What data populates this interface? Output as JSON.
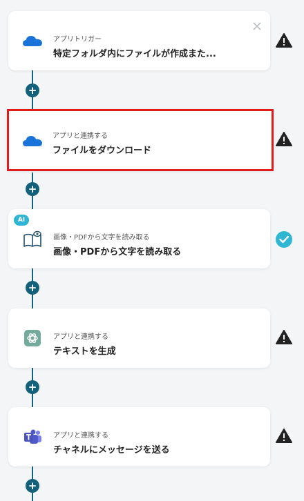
{
  "steps": [
    {
      "subtitle": "アプリトリガー",
      "title": "特定フォルダ内にファイルが作成また...",
      "icon": "onedrive-icon",
      "status": "warning"
    },
    {
      "subtitle": "アプリと連携する",
      "title": "ファイルをダウンロード",
      "icon": "onedrive-icon",
      "status": "warning"
    },
    {
      "subtitle": "画像・PDFから文字を読み取る",
      "title": "画像・PDFから文字を読み取る",
      "icon": "ocr-book-icon",
      "status": "done",
      "badge": "AI"
    },
    {
      "subtitle": "アプリと連携する",
      "title": "テキストを生成",
      "icon": "chatgpt-icon",
      "status": "warning"
    },
    {
      "subtitle": "アプリと連携する",
      "title": "チャネルにメッセージを送る",
      "icon": "teams-icon",
      "status": "warning"
    }
  ],
  "colors": {
    "connector": "#13607a",
    "selected_border": "#e01c1c",
    "done": "#2eb6d3",
    "warning": "#222222",
    "onedrive": "#1a73d9",
    "chatgpt": "#74aa9c",
    "teams": "#5059c9"
  }
}
